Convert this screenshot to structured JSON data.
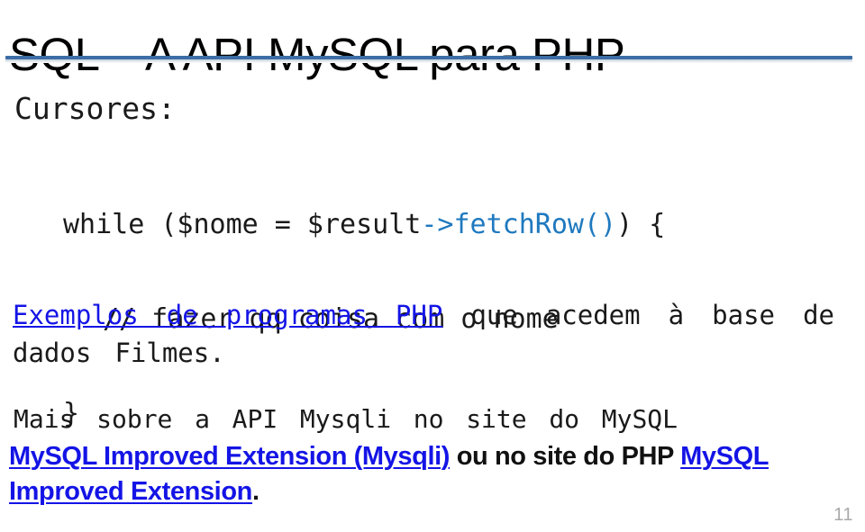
{
  "slide": {
    "title": "SQL – A API MySQL para PHP",
    "page_number": "11",
    "accent_color": "#3c6ea5",
    "link_color": "#1414e6",
    "code_method_color": "#1f79bf",
    "text_color": "#1a1a1a",
    "page_number_color": "#a9a9a9",
    "background_color": "#ffffff"
  },
  "body": {
    "section_heading": "Cursores:",
    "code": {
      "line1_before": "while ($nome = $result",
      "line1_method": "->fetchRow()",
      "line1_after": ") {",
      "line2": "// fazer qq coisa com o nome",
      "line3": "}"
    },
    "paragraph_exemplos": {
      "link_text": "Exemplos de programas PHP",
      "rest_text": " que acedem à base de dados Filmes."
    },
    "paragraph_mais": "Mais sobre a API Mysqli no site do MySQL",
    "paragraph_links": {
      "link1": "MySQL Improved Extension (Mysqli)",
      "middle": " ou no site do PHP ",
      "link2": "MySQL Improved Extension",
      "trailing": "."
    }
  }
}
